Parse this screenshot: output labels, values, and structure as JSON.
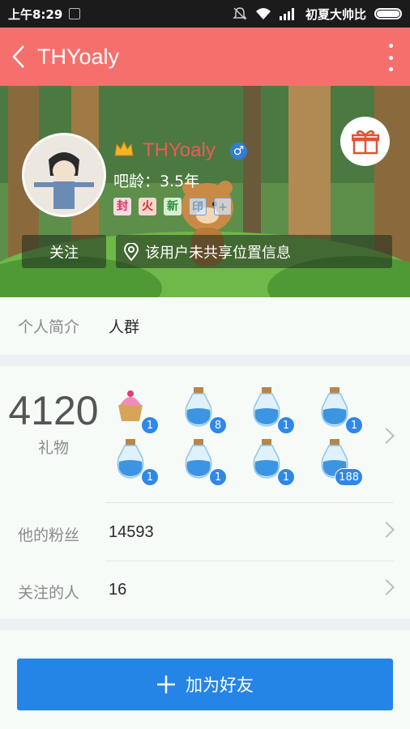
{
  "status_bar": {
    "time": "上午8:29",
    "carrier": "初夏大帅比"
  },
  "header": {
    "title": "THYoaly"
  },
  "profile": {
    "username": "THYoaly",
    "age": "吧龄：3.5年",
    "badges": [
      {
        "text": "封",
        "color": "#d9355b"
      },
      {
        "text": "火",
        "color": "#d12b2b"
      },
      {
        "text": "新",
        "color": "#2b8f3a"
      },
      {
        "text": "印",
        "color": "#6fa0d8"
      },
      {
        "text": "+",
        "color": "#6fa0d8"
      }
    ],
    "follow_label": "关注",
    "location_text": "该用户未共享位置信息"
  },
  "intro": {
    "label": "个人简介",
    "value": "人群"
  },
  "gifts": {
    "count": "4120",
    "label": "礼物",
    "items": [
      {
        "type": "cupcake",
        "count": "1"
      },
      {
        "type": "bottle",
        "count": "8"
      },
      {
        "type": "bottle",
        "count": "1"
      },
      {
        "type": "bottle",
        "count": "1"
      },
      {
        "type": "bottle",
        "count": "1"
      },
      {
        "type": "bottle",
        "count": "1"
      },
      {
        "type": "bottle",
        "count": "1"
      },
      {
        "type": "bottle",
        "count": "188"
      }
    ]
  },
  "fans": {
    "label": "他的粉丝",
    "value": "14593"
  },
  "following": {
    "label": "关注的人",
    "value": "16"
  },
  "add_friend": {
    "label": "加为好友"
  },
  "colors": {
    "header": "#f5706c",
    "accent": "#2585e6",
    "username": "#ee5a54"
  }
}
